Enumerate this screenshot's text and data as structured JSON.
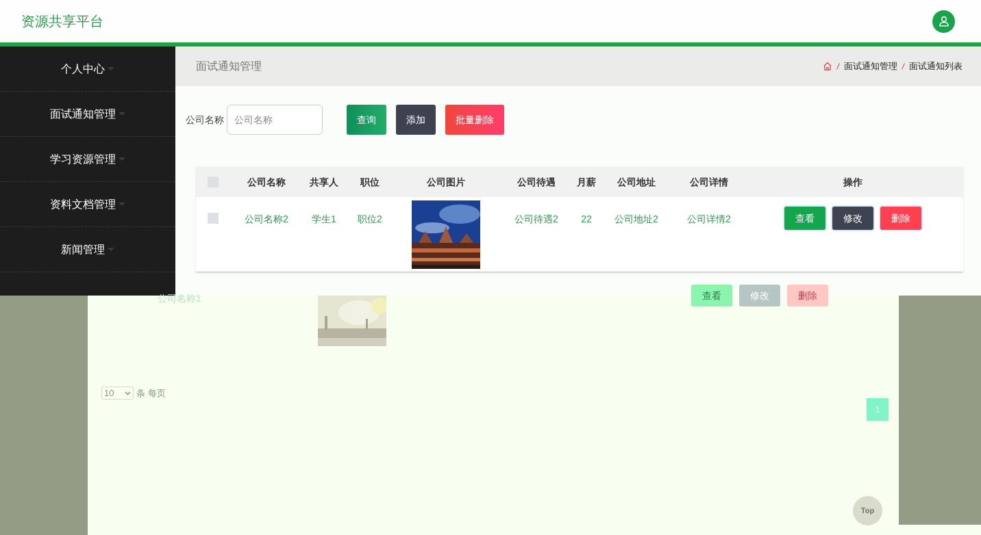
{
  "header": {
    "title": "资源共享平台"
  },
  "sidebar": {
    "items": [
      {
        "label": "个人中心"
      },
      {
        "label": "面试通知管理"
      },
      {
        "label": "学习资源管理"
      },
      {
        "label": "资料文档管理"
      },
      {
        "label": "新闻管理"
      }
    ]
  },
  "page_title": "面试通知管理",
  "breadcrumb": [
    "面试通知管理",
    "面试通知列表"
  ],
  "search": {
    "label": "公司名称",
    "placeholder": "公司名称"
  },
  "buttons": [
    {
      "label": "查询",
      "kind": "query"
    },
    {
      "label": "添加",
      "kind": "add"
    },
    {
      "label": "批量删除",
      "kind": "batch_delete"
    }
  ],
  "table": {
    "select_all": {
      "checked": false
    },
    "columns": [
      "公司名称",
      "共享人",
      "职位",
      "公司图片",
      "公司待遇",
      "月薪",
      "公司地址",
      "公司详情",
      "操作"
    ],
    "rows": [
      {
        "checked": false,
        "cells": [
          "公司名称2",
          "学生1",
          "职位2",
          {
            "kind": "picture"
          },
          "公司待遇2",
          "22",
          "公司地址2",
          "公司详情2"
        ],
        "actions": [
          {
            "label": "查看",
            "kind": "view"
          },
          {
            "label": "修改",
            "kind": "edit"
          },
          {
            "label": "删除",
            "kind": "delete"
          }
        ]
      }
    ]
  },
  "faded_row": {
    "company": "公司名称1",
    "actions": [
      {
        "label": "查看",
        "kind": "view"
      },
      {
        "label": "修改",
        "kind": "edit"
      },
      {
        "label": "删除",
        "kind": "delete"
      }
    ]
  },
  "page_size": {
    "value": "10",
    "suffix": "条 每页"
  },
  "pagination": [
    {
      "label": "1",
      "selected": true
    }
  ],
  "back_to_top": "Top"
}
